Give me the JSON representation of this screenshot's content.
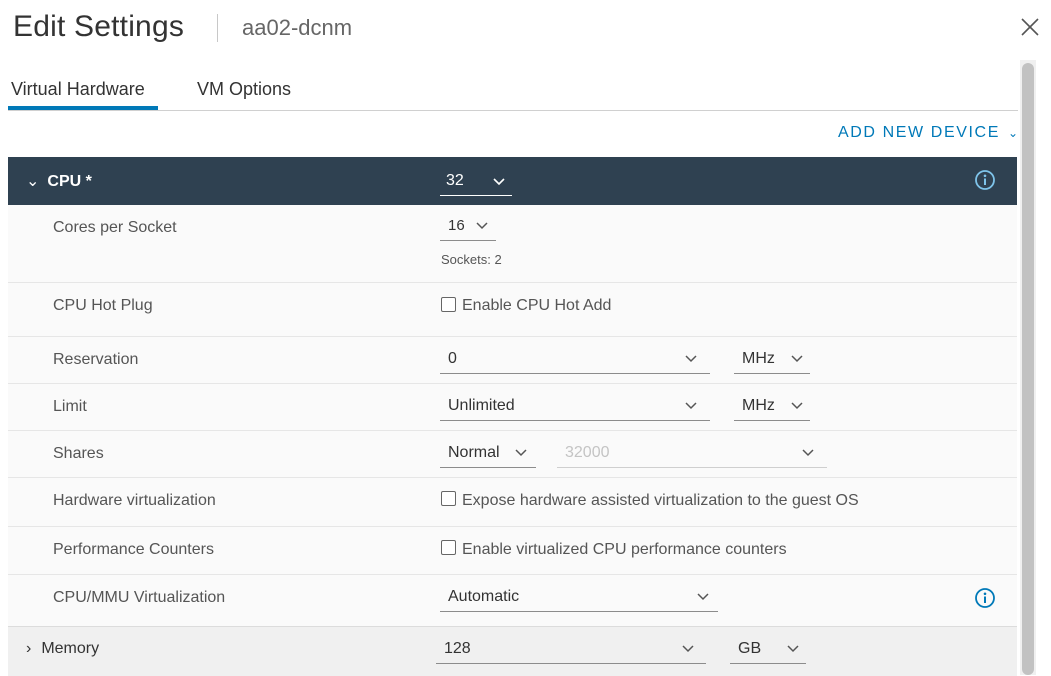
{
  "dialog": {
    "title": "Edit Settings",
    "subtitle": "aa02-dcnm",
    "close_icon": "close-icon"
  },
  "tabs": [
    {
      "label": "Virtual Hardware",
      "active": true
    },
    {
      "label": "VM Options",
      "active": false
    }
  ],
  "toolbar": {
    "add_device_label": "ADD NEW DEVICE",
    "add_device_chevron": "⌄"
  },
  "cpu": {
    "label": "CPU *",
    "expand_chevron": "⌄",
    "value": "32",
    "info_icon": "info-icon"
  },
  "rows": {
    "cores_per_socket": {
      "label": "Cores per Socket",
      "value": "16",
      "note": "Sockets: 2"
    },
    "cpu_hot_plug": {
      "label": "CPU Hot Plug",
      "checkbox_label": "Enable CPU Hot Add",
      "checked": false
    },
    "reservation": {
      "label": "Reservation",
      "value": "0",
      "unit": "MHz"
    },
    "limit": {
      "label": "Limit",
      "value": "Unlimited",
      "unit": "MHz"
    },
    "shares": {
      "label": "Shares",
      "level": "Normal",
      "value": "32000"
    },
    "hw_virtualization": {
      "label": "Hardware virtualization",
      "checkbox_label": "Expose hardware assisted virtualization to the guest OS",
      "checked": false
    },
    "perf_counters": {
      "label": "Performance Counters",
      "checkbox_label": "Enable virtualized CPU performance counters",
      "checked": false
    },
    "mmu_virtualization": {
      "label": "CPU/MMU Virtualization",
      "value": "Automatic"
    }
  },
  "memory": {
    "label": "Memory",
    "expand_chevron": "›",
    "value": "128",
    "unit": "GB"
  },
  "colors": {
    "accent": "#0079b8",
    "header_bg": "#2f4151"
  }
}
